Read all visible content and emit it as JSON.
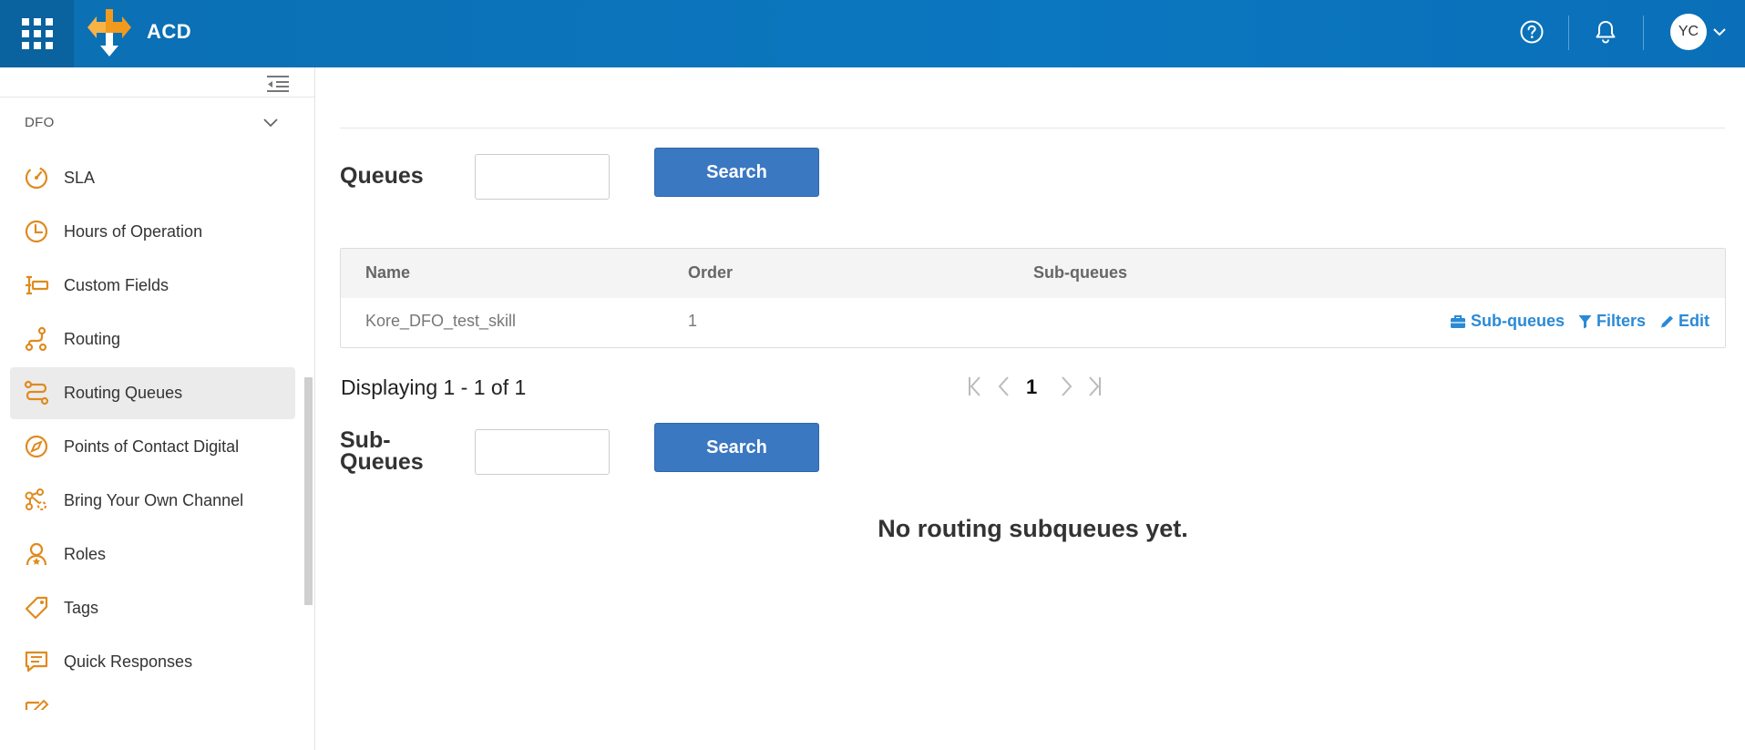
{
  "header": {
    "app_title": "ACD",
    "avatar_initials": "YC",
    "brand_color": "#0b6fb3"
  },
  "sidebar": {
    "section_title": "DFO",
    "icon_color": "#e08a1e",
    "items": [
      {
        "label": "SLA",
        "icon": "gauge-icon"
      },
      {
        "label": "Hours of Operation",
        "icon": "clock-icon"
      },
      {
        "label": "Custom Fields",
        "icon": "custom-fields-icon"
      },
      {
        "label": "Routing",
        "icon": "routing-icon"
      },
      {
        "label": "Routing Queues",
        "icon": "routing-queues-icon",
        "active": true
      },
      {
        "label": "Points of Contact Digital",
        "icon": "compass-icon"
      },
      {
        "label": "Bring Your Own Channel",
        "icon": "channel-hub-icon"
      },
      {
        "label": "Roles",
        "icon": "user-role-icon"
      },
      {
        "label": "Tags",
        "icon": "tag-icon"
      },
      {
        "label": "Quick Responses",
        "icon": "chat-icon"
      }
    ]
  },
  "queues": {
    "title": "Queues",
    "search_value": "",
    "search_button": "Search",
    "columns": [
      "Name",
      "Order",
      "Sub-queues"
    ],
    "rows": [
      {
        "name": "Kore_DFO_test_skill",
        "order": "1",
        "subqueues": ""
      }
    ],
    "row_actions": {
      "subqueues": "Sub-queues",
      "filters": "Filters",
      "edit": "Edit"
    },
    "pager": {
      "info": "Displaying 1 - 1 of 1",
      "current_page": "1"
    }
  },
  "subqueues": {
    "title_line1": "Sub-",
    "title_line2": "Queues",
    "search_value": "",
    "search_button": "Search",
    "empty_message": "No routing subqueues yet."
  }
}
